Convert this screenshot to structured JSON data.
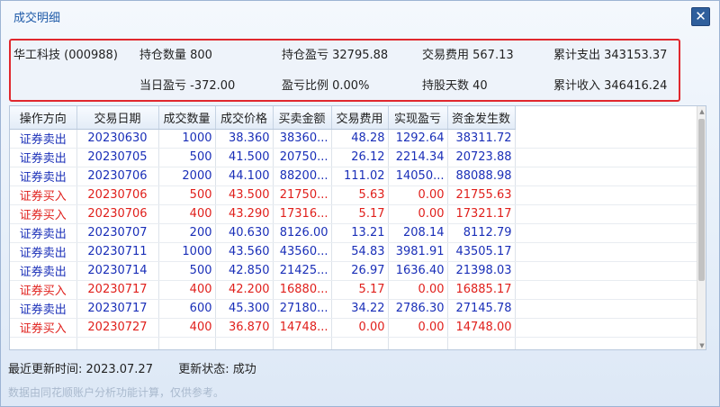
{
  "window": {
    "title": "成交明细",
    "close_glyph": "✕"
  },
  "summary": {
    "stock": "华工科技 (000988)",
    "position_qty": "持仓数量 800",
    "position_pnl": "持仓盈亏 32795.88",
    "trade_fee": "交易费用 567.13",
    "total_out": "累计支出 343153.37",
    "day_pnl": "当日盈亏 -372.00",
    "pnl_ratio": "盈亏比例 0.00%",
    "hold_days": "持股天数 40",
    "total_in": "累计收入 346416.24"
  },
  "table": {
    "headers": [
      "操作方向",
      "交易日期",
      "成交数量",
      "成交价格",
      "买卖金额",
      "交易费用",
      "实现盈亏",
      "资金发生数"
    ],
    "rows": [
      {
        "type": "sell",
        "cells": [
          "证券卖出",
          "20230630",
          "1000",
          "38.360",
          "38360...",
          "48.28",
          "1292.64",
          "38311.72"
        ]
      },
      {
        "type": "sell",
        "cells": [
          "证券卖出",
          "20230705",
          "500",
          "41.500",
          "20750...",
          "26.12",
          "2214.34",
          "20723.88"
        ]
      },
      {
        "type": "sell",
        "cells": [
          "证券卖出",
          "20230706",
          "2000",
          "44.100",
          "88200...",
          "111.02",
          "14050...",
          "88088.98"
        ]
      },
      {
        "type": "buy",
        "cells": [
          "证券买入",
          "20230706",
          "500",
          "43.500",
          "21750...",
          "5.63",
          "0.00",
          "21755.63"
        ]
      },
      {
        "type": "buy",
        "cells": [
          "证券买入",
          "20230706",
          "400",
          "43.290",
          "17316...",
          "5.17",
          "0.00",
          "17321.17"
        ]
      },
      {
        "type": "sell",
        "cells": [
          "证券卖出",
          "20230707",
          "200",
          "40.630",
          "8126.00",
          "13.21",
          "208.14",
          "8112.79"
        ]
      },
      {
        "type": "sell",
        "cells": [
          "证券卖出",
          "20230711",
          "1000",
          "43.560",
          "43560...",
          "54.83",
          "3981.91",
          "43505.17"
        ]
      },
      {
        "type": "sell",
        "cells": [
          "证券卖出",
          "20230714",
          "500",
          "42.850",
          "21425...",
          "26.97",
          "1636.40",
          "21398.03"
        ]
      },
      {
        "type": "buy",
        "cells": [
          "证券买入",
          "20230717",
          "400",
          "42.200",
          "16880...",
          "5.17",
          "0.00",
          "16885.17"
        ]
      },
      {
        "type": "sell",
        "cells": [
          "证券卖出",
          "20230717",
          "600",
          "45.300",
          "27180...",
          "34.22",
          "2786.30",
          "27145.78"
        ]
      },
      {
        "type": "buy",
        "cells": [
          "证券买入",
          "20230727",
          "400",
          "36.870",
          "14748...",
          "0.00",
          "0.00",
          "14748.00"
        ]
      }
    ]
  },
  "colors": {
    "sell_text": "#1a2fb8",
    "buy_text": "#e0201c",
    "highlight_border": "#e0282e"
  },
  "status": {
    "last_update_label": "最近更新时间:",
    "last_update_value": "2023.07.27",
    "update_state_label": "更新状态:",
    "update_state_value": "成功"
  },
  "disclaimer": "数据由同花顺账户分析功能计算，仅供参考。"
}
